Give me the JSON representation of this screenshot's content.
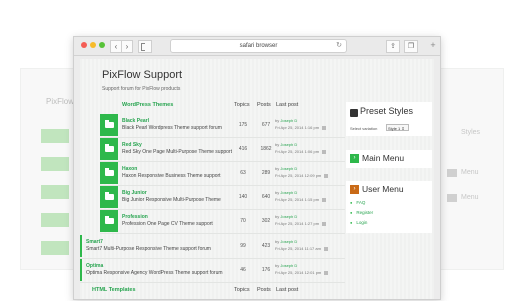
{
  "browser": {
    "address": "safari browser"
  },
  "ghost_left": {
    "title": "PixFlow"
  },
  "ghost_right": {
    "items": [
      "Styles",
      "Menu",
      "Menu"
    ]
  },
  "site": {
    "title": "PixFlow Support",
    "subtitle": "Support forum for PixFlow products"
  },
  "table": {
    "section_title": "WordPress Themes",
    "col_topics": "Topics",
    "col_posts": "Posts",
    "col_last": "Last post",
    "by_prefix": "by",
    "rows": [
      {
        "name": "Black Pearl",
        "desc": "Black Pearl Wordpress Theme support forum",
        "topics": "175",
        "posts": "677",
        "user": "Joseph D",
        "date": "Fri Apr 25, 2014 1:16 pm"
      },
      {
        "name": "Red Sky",
        "desc": "Red Sky One Page Multi-Purpose Theme support",
        "topics": "416",
        "posts": "1862",
        "user": "Joseph D",
        "date": "Fri Apr 25, 2014 1:06 pm"
      },
      {
        "name": "Haxon",
        "desc": "Haxon Responsive Business Theme support",
        "topics": "63",
        "posts": "289",
        "user": "Joseph D",
        "date": "Fri Apr 25, 2014 12:09 pm"
      },
      {
        "name": "Big Junior",
        "desc": "Big Junior Responsive Multi-Purpose Theme",
        "topics": "140",
        "posts": "640",
        "user": "Joseph D",
        "date": "Fri Apr 25, 2014 1:15 pm"
      },
      {
        "name": "Profession",
        "desc": "Profession One Page CV Theme support",
        "topics": "70",
        "posts": "302",
        "user": "Joseph D",
        "date": "Fri Apr 25, 2014 1:27 pm"
      }
    ],
    "flat_rows": [
      {
        "name": "Smart7",
        "desc": "Smart7 Multi-Purpose Responsive Theme support forum",
        "topics": "99",
        "posts": "423",
        "user": "Joseph D",
        "date": "Fri Apr 25, 2014 11:17 am"
      },
      {
        "name": "Optima",
        "desc": "Optima Responsive Agency WordPress Theme support forum",
        "topics": "46",
        "posts": "176",
        "user": "Joseph D",
        "date": "Fri Apr 25, 2014 12:01 pm"
      }
    ],
    "footer_section": "HTML Templates",
    "footer_topics": "Topics",
    "footer_posts": "Posts",
    "footer_last": "Last post"
  },
  "sidebar": {
    "preset_title": "Preset Styles",
    "select_label": "Select variation",
    "select_value": "Style 1 ⇕",
    "main_menu_title": "Main Menu",
    "user_menu_title": "User Menu",
    "user_links": [
      "FAQ",
      "Register",
      "Login"
    ]
  },
  "colors": {
    "accent": "#2eb84b",
    "user_menu_icon": "#c96a17"
  }
}
